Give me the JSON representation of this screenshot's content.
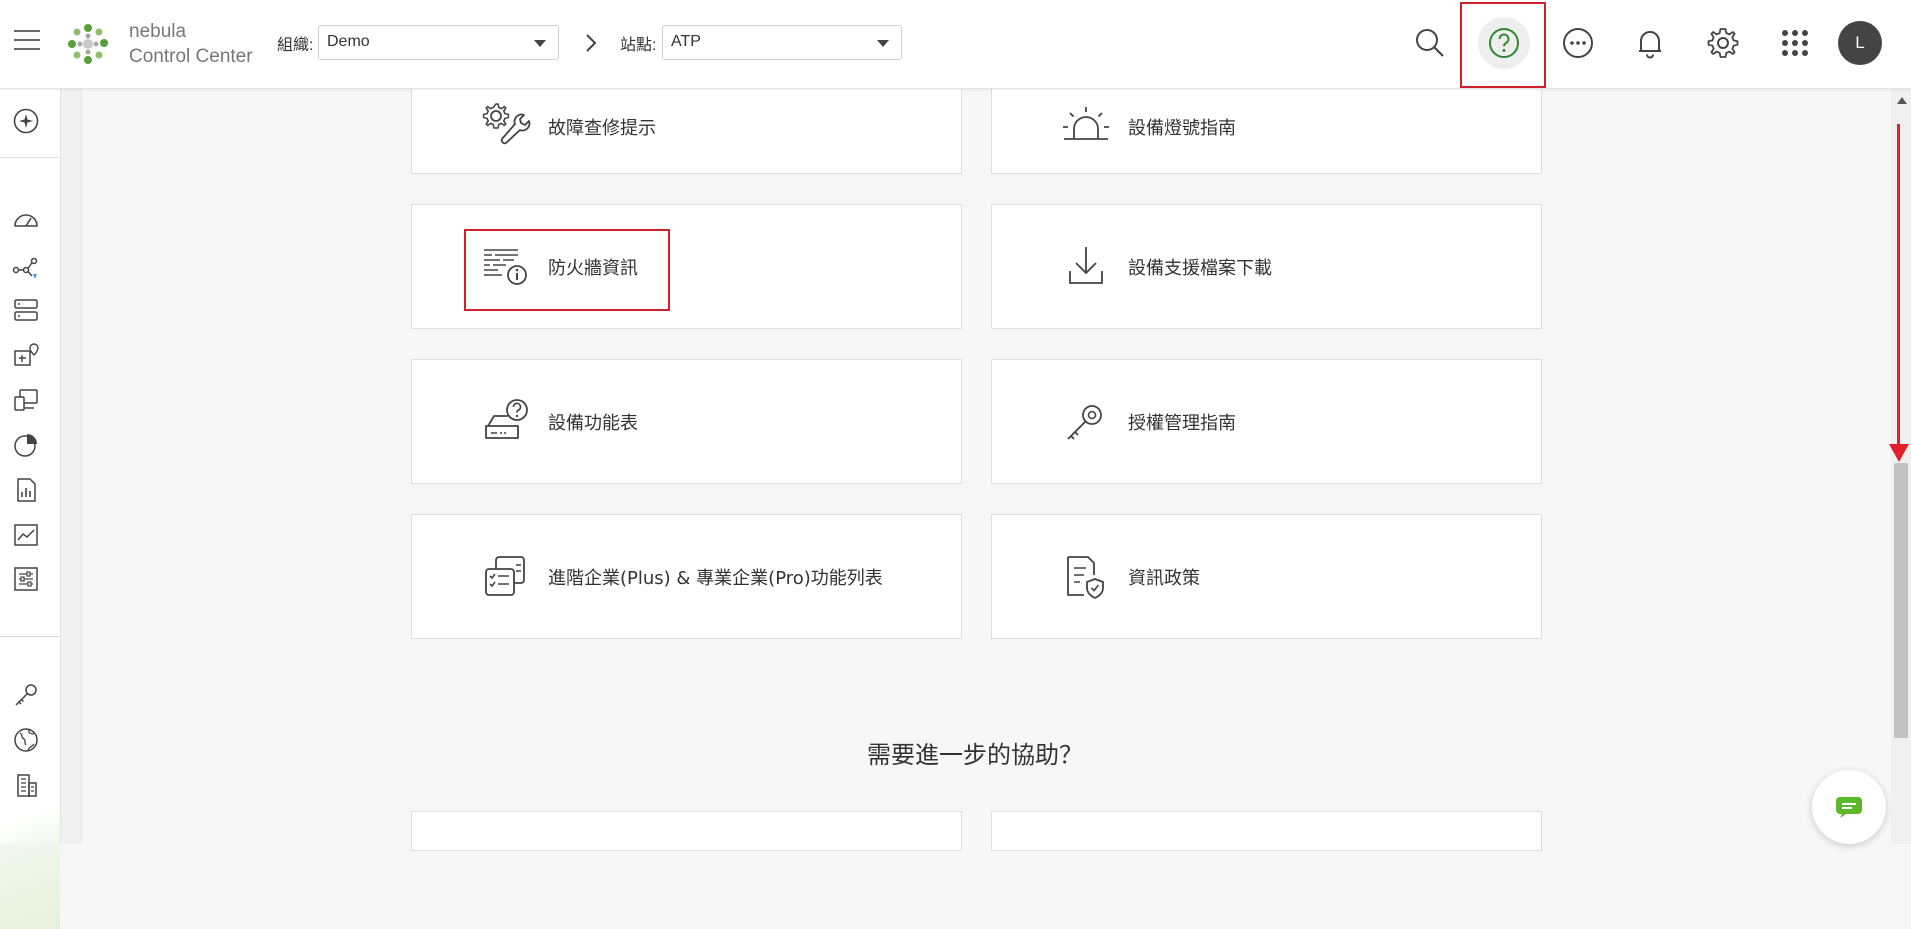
{
  "header": {
    "brand_line1": "nebula",
    "brand_line2": "Control Center",
    "org_label": "組織:",
    "org_value": "Demo",
    "site_label": "站點:",
    "site_value": "ATP",
    "avatar_initial": "L",
    "icons": [
      "menu-icon",
      "search-icon",
      "help-icon",
      "more-icon",
      "bell-icon",
      "gear-icon",
      "apps-grid-icon"
    ]
  },
  "sidebar": {
    "icons": [
      "ai-assistant-icon",
      "dashboard-icon",
      "topology-icon",
      "devices-icon",
      "site-map-icon",
      "clients-icon",
      "reports-pie-icon",
      "report-doc-icon",
      "monitor-chart-icon",
      "configure-sliders-icon",
      "license-key-icon",
      "world-icon",
      "building-icon"
    ]
  },
  "cards": [
    {
      "label": "故障查修提示",
      "icon": "troubleshoot-gear-wrench-icon"
    },
    {
      "label": "設備燈號指南",
      "icon": "led-siren-icon"
    },
    {
      "label": "防火牆資訊",
      "icon": "firewall-info-icon"
    },
    {
      "label": "設備支援檔案下載",
      "icon": "download-icon"
    },
    {
      "label": "設備功能表",
      "icon": "device-question-icon"
    },
    {
      "label": "授權管理指南",
      "icon": "license-key-icon"
    },
    {
      "label": "進階企業(Plus) & 專業企業(Pro)功能列表",
      "icon": "feature-checklist-icon"
    },
    {
      "label": "資訊政策",
      "icon": "policy-document-shield-icon"
    }
  ],
  "help_section": {
    "title": "需要進一步的協助？"
  },
  "colors": {
    "accent_green": "#2f8a2f",
    "annotation_red": "#d0202a",
    "chat_green": "#5cb82a"
  }
}
